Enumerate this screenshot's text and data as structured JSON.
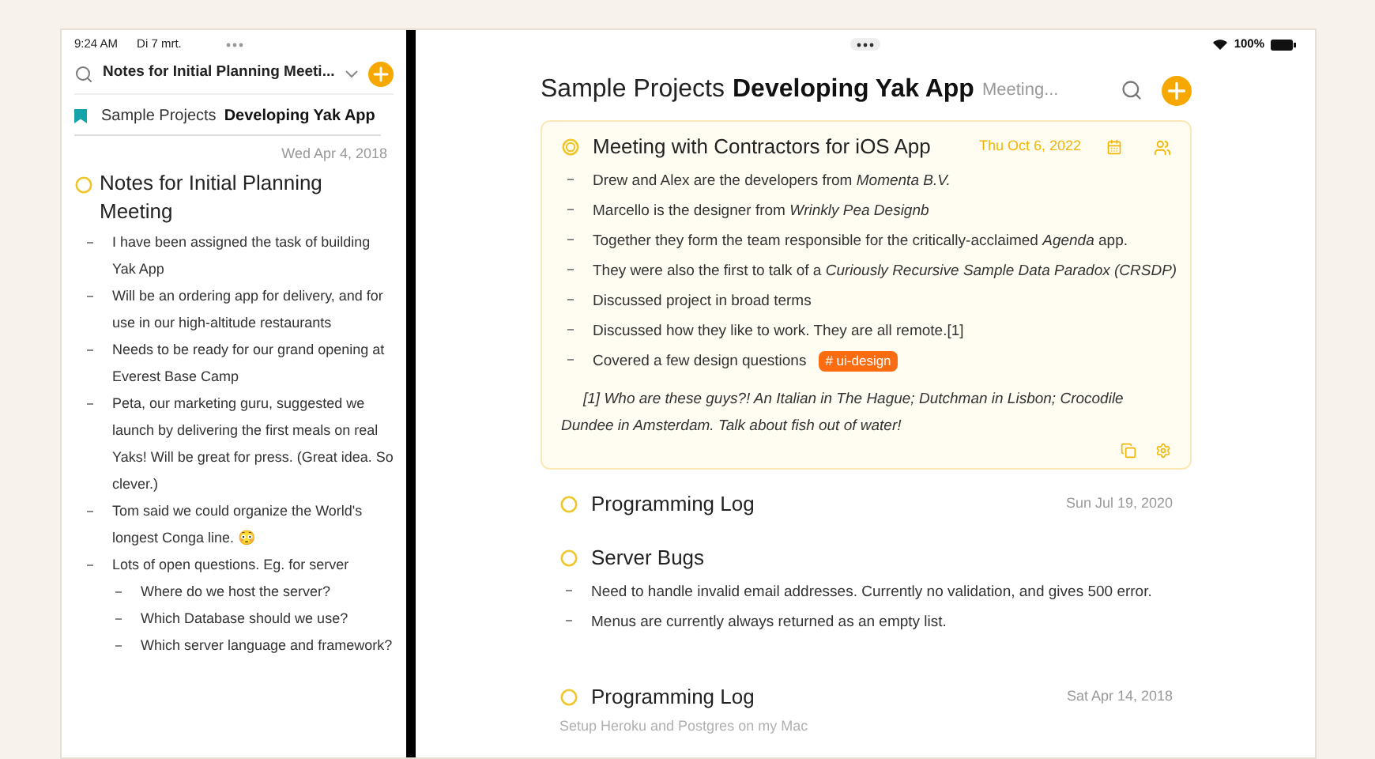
{
  "status_bar": {
    "time": "9:24 AM",
    "date": "Di 7 mrt.",
    "battery": "100%"
  },
  "sidebar": {
    "search_title": "Notes for Initial Planning Meeti...",
    "breadcrumb": {
      "parent": "Sample Projects",
      "project": "Developing Yak App"
    },
    "date": "Wed Apr 4, 2018",
    "note_title": "Notes for Initial Planning Meeting",
    "items": [
      {
        "text": "I have been assigned the task of building Yak App"
      },
      {
        "text": "Will be an ordering app for delivery, and for use in our high-altitude restaurants"
      },
      {
        "text": "Needs to be ready for our grand opening at Everest Base Camp"
      },
      {
        "text": "Peta, our marketing guru, suggested we launch by delivering the first meals on real Yaks! Will be great for press. (Great idea. So clever.)"
      },
      {
        "text": "Tom said we could organize the World's longest Conga line. 😳"
      },
      {
        "text": "Lots of open questions. Eg. for server",
        "children": [
          {
            "text": "Where do we host the server?"
          },
          {
            "text": "Which Database should we use?"
          },
          {
            "text": "Which server language and framework?"
          }
        ]
      }
    ]
  },
  "header": {
    "parent": "Sample Projects",
    "project": "Developing Yak App",
    "note": "Meeting..."
  },
  "notes": [
    {
      "title": "Meeting with Contractors for iOS App",
      "date": "Thu Oct 6, 2022",
      "selected": true,
      "items": [
        {
          "text": "Drew and Alex are the developers from *Momenta B.V.*"
        },
        {
          "text": "Marcello is the designer from *Wrinkly Pea Designb*"
        },
        {
          "text": "Together they form the team responsible for the critically-acclaimed *Agenda* app."
        },
        {
          "text": "They were also the first to talk of a *Curiously Recursive Sample Data Paradox (CRSDP)*"
        },
        {
          "text": "Discussed project in broad terms"
        },
        {
          "text": "Discussed how they like to work. They are all remote.[1]"
        },
        {
          "text": "Covered a few design questions",
          "tag": "# ui-design"
        }
      ],
      "footnote": "[1] Who are these guys?! An Italian in The Hague; Dutchman in Lisbon; Crocodile Dundee in Amsterdam. Talk about fish out of water!"
    },
    {
      "title": "Programming Log",
      "date": "Sun Jul 19, 2020",
      "selected": false
    },
    {
      "title": "Server Bugs",
      "selected": false,
      "items": [
        {
          "text": "Need to handle invalid email addresses. Currently no validation, and gives 500 error."
        },
        {
          "text": "Menus are currently always returned as an empty list."
        }
      ]
    },
    {
      "title": "Programming Log",
      "date": "Sat Apr 14, 2018",
      "selected": false,
      "subtitle": "Setup Heroku and Postgres on my Mac"
    }
  ]
}
